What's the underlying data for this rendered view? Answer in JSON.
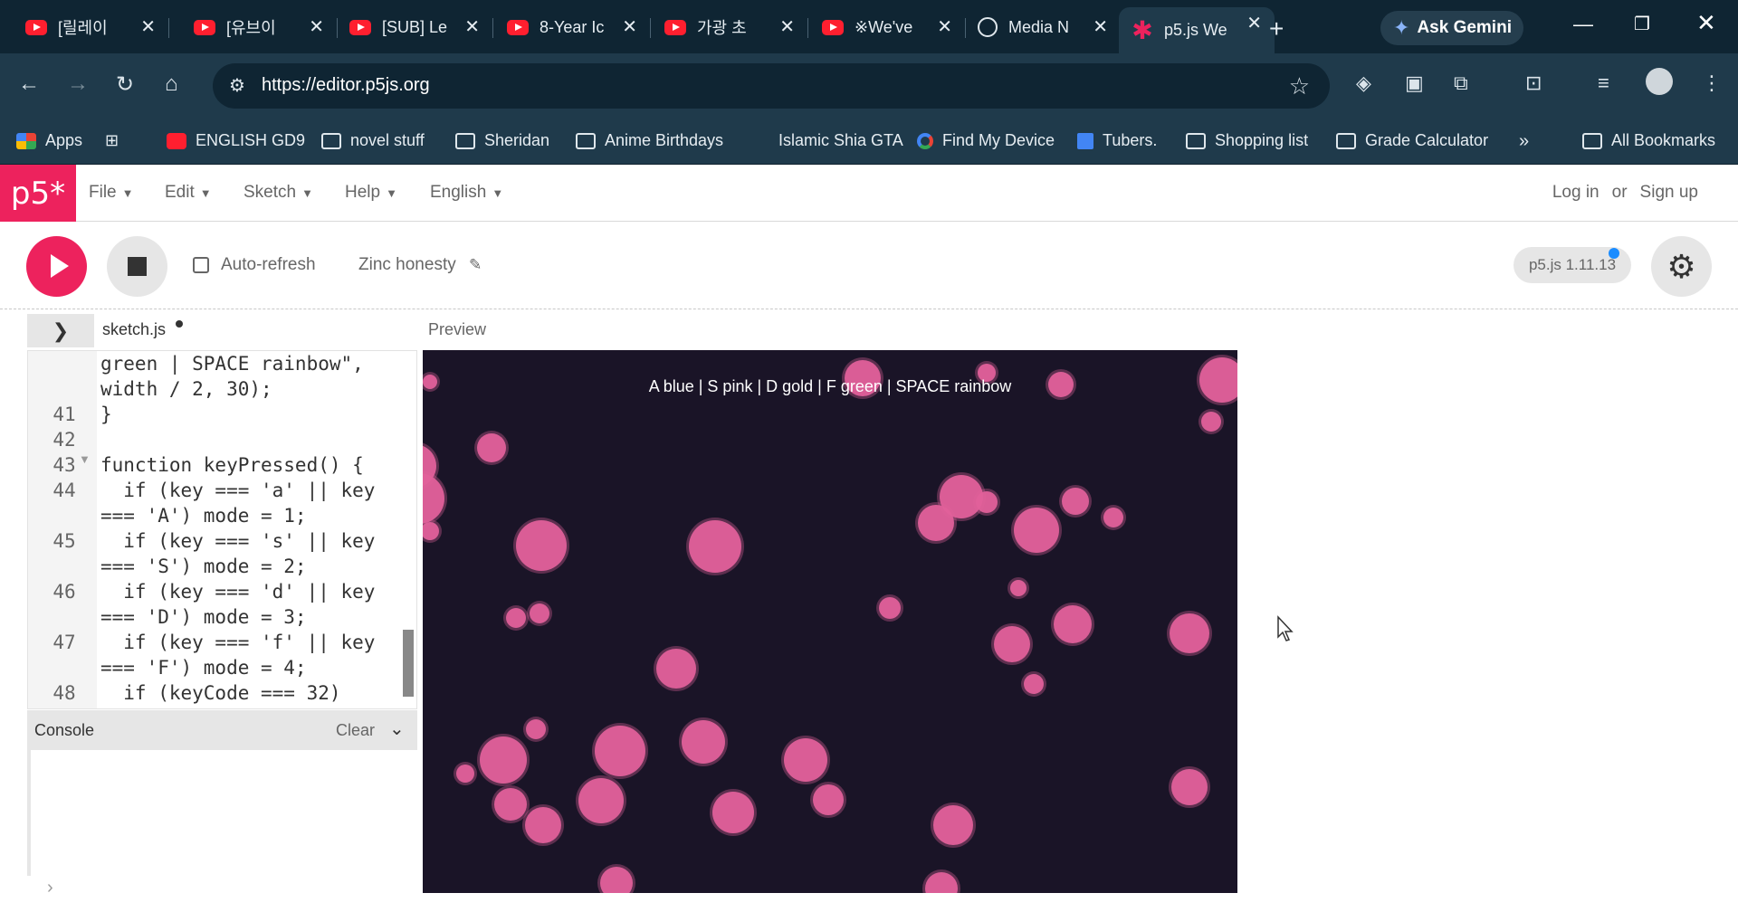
{
  "browser": {
    "tabs": [
      {
        "label": "[릴레이",
        "icon": "youtube-icon"
      },
      {
        "label": "[유브이",
        "icon": "youtube-icon"
      },
      {
        "label": "[SUB] Le",
        "icon": "youtube-icon"
      },
      {
        "label": "8-Year Ic",
        "icon": "youtube-icon"
      },
      {
        "label": "가광 초",
        "icon": "youtube-icon"
      },
      {
        "label": "※We've",
        "icon": "youtube-icon"
      },
      {
        "label": "Media N",
        "icon": "globe-icon"
      },
      {
        "label": "p5.js We",
        "icon": "p5-asterisk-icon"
      }
    ],
    "gemini_label": "Ask Gemini",
    "url": "https://editor.p5js.org",
    "bookmarks": [
      {
        "label": "Apps"
      },
      {
        "label": "ENGLISH GD9"
      },
      {
        "label": "novel stuff"
      },
      {
        "label": "Sheridan"
      },
      {
        "label": "Anime Birthdays"
      },
      {
        "label": "Islamic Shia GTA"
      },
      {
        "label": "Find My Device"
      },
      {
        "label": "Tubers."
      },
      {
        "label": "Shopping list"
      },
      {
        "label": "Grade Calculator"
      },
      {
        "label": "All Bookmarks"
      }
    ],
    "overflow_label": "»"
  },
  "p5": {
    "logo": "p5*",
    "menus": [
      "File",
      "Edit",
      "Sketch",
      "Help",
      "English"
    ],
    "login": "Log in",
    "or": "or",
    "signup": "Sign up",
    "auto_refresh": "Auto-refresh",
    "sketch_name": "Zinc honesty",
    "version": "p5.js 1.11.13",
    "file_tab": "sketch.js",
    "preview_label": "Preview",
    "console_label": "Console",
    "clear_label": "Clear",
    "prompt": "›"
  },
  "code": {
    "lines": [
      {
        "num": "",
        "text": "green | SPACE rainbow\","
      },
      {
        "num": "",
        "text": "width / 2, 30);"
      },
      {
        "num": "41",
        "text": "}"
      },
      {
        "num": "42",
        "text": ""
      },
      {
        "num": "43",
        "text": "function keyPressed() {"
      },
      {
        "num": "44",
        "text": "  if (key === 'a' || key"
      },
      {
        "num": "",
        "text": "=== 'A') mode = 1;"
      },
      {
        "num": "45",
        "text": "  if (key === 's' || key"
      },
      {
        "num": "",
        "text": "=== 'S') mode = 2;"
      },
      {
        "num": "46",
        "text": "  if (key === 'd' || key"
      },
      {
        "num": "",
        "text": "=== 'D') mode = 3;"
      },
      {
        "num": "47",
        "text": "  if (key === 'f' || key"
      },
      {
        "num": "",
        "text": "=== 'F') mode = 4;"
      },
      {
        "num": "48",
        "text": "  if (keyCode === 32)"
      }
    ]
  },
  "canvas": {
    "instructions": "A blue | S pink | D gold | F green | SPACE rainbow",
    "bubble_color": "#e0609a",
    "background": "#1a1427",
    "bubbles": [
      [
        475,
        422,
        8
      ],
      [
        458,
        515,
        24
      ],
      [
        463,
        551,
        28
      ],
      [
        475,
        587,
        10
      ],
      [
        543,
        495,
        16
      ],
      [
        598,
        603,
        28
      ],
      [
        592,
        806,
        11
      ],
      [
        570,
        683,
        11
      ],
      [
        596,
        678,
        11
      ],
      [
        514,
        855,
        10
      ],
      [
        556,
        840,
        26
      ],
      [
        564,
        889,
        18
      ],
      [
        600,
        912,
        20
      ],
      [
        664,
        885,
        25
      ],
      [
        685,
        830,
        28
      ],
      [
        681,
        976,
        18
      ],
      [
        747,
        739,
        22
      ],
      [
        777,
        820,
        24
      ],
      [
        790,
        604,
        29
      ],
      [
        810,
        898,
        23
      ],
      [
        890,
        840,
        24
      ],
      [
        915,
        884,
        17
      ],
      [
        953,
        418,
        20
      ],
      [
        1053,
        912,
        22
      ],
      [
        1034,
        578,
        20
      ],
      [
        1062,
        549,
        24
      ],
      [
        1090,
        555,
        12
      ],
      [
        1118,
        712,
        20
      ],
      [
        1125,
        650,
        9
      ],
      [
        1142,
        756,
        11
      ],
      [
        1145,
        586,
        25
      ],
      [
        1172,
        425,
        14
      ],
      [
        1185,
        690,
        21
      ],
      [
        1188,
        554,
        15
      ],
      [
        1230,
        572,
        11
      ],
      [
        1090,
        412,
        10
      ],
      [
        1040,
        982,
        18
      ],
      [
        1314,
        870,
        20
      ],
      [
        1314,
        700,
        22
      ],
      [
        1338,
        466,
        11
      ],
      [
        1350,
        420,
        25
      ],
      [
        983,
        672,
        12
      ]
    ]
  }
}
